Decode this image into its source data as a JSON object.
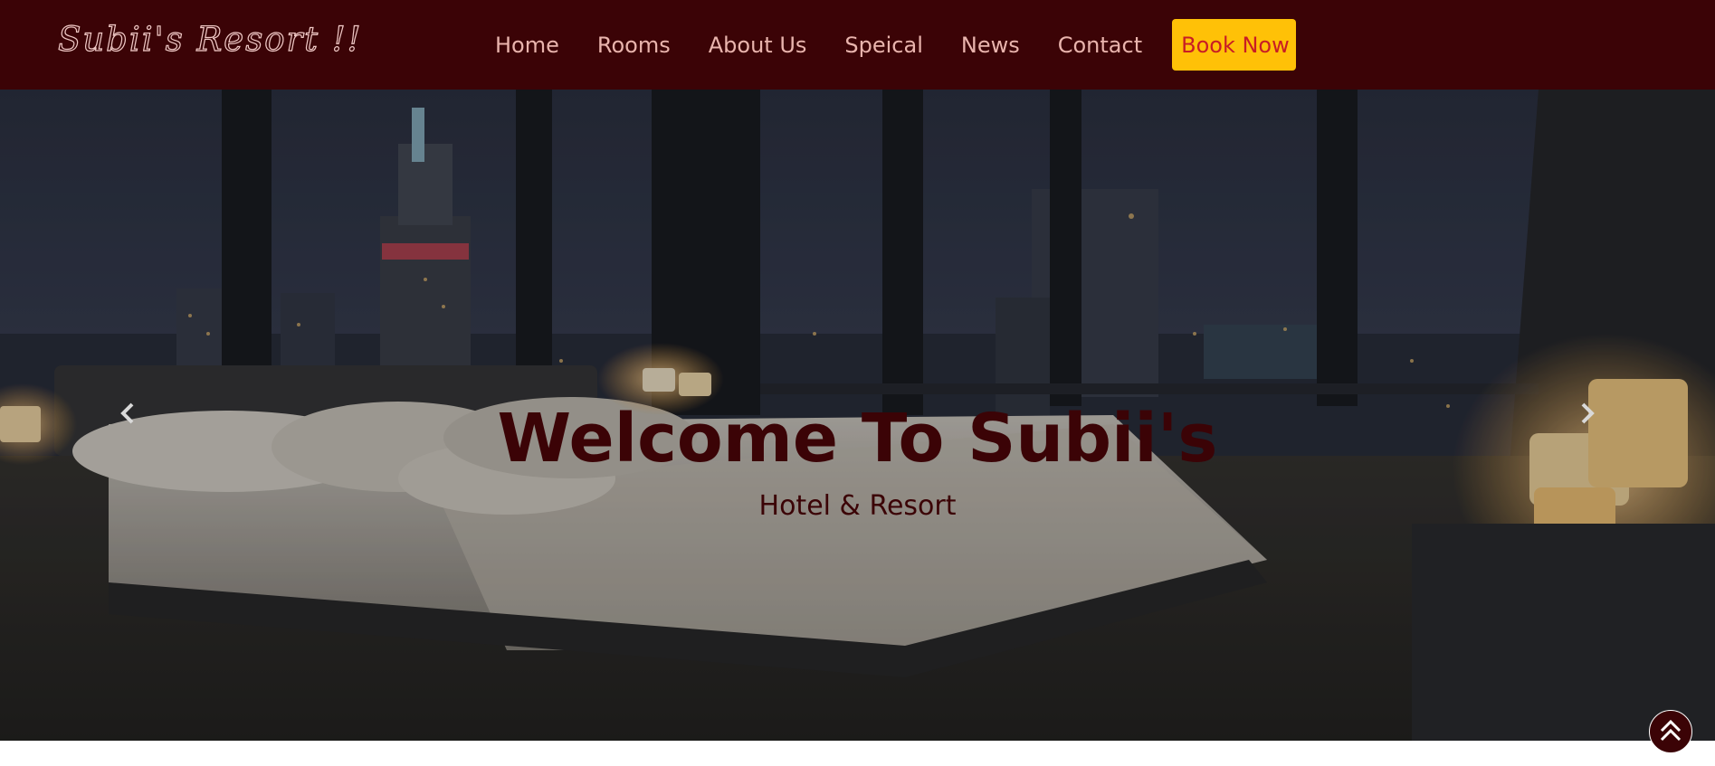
{
  "brand": {
    "name": "Subii's Resort !!"
  },
  "nav": {
    "items": [
      {
        "label": "Home"
      },
      {
        "label": "Rooms"
      },
      {
        "label": "About Us"
      },
      {
        "label": "Speical"
      },
      {
        "label": "News"
      },
      {
        "label": "Contact"
      }
    ],
    "cta_label": "Book Now"
  },
  "hero": {
    "title": "Welcome To Subii's",
    "subtitle": "Hotel & Resort",
    "prev_icon": "chevron-left-icon",
    "next_icon": "chevron-right-icon"
  },
  "scroll_top": {
    "icon": "double-chevron-up-icon"
  },
  "colors": {
    "navbar_bg": "#3b0306",
    "nav_text": "#e9b4ad",
    "cta_bg": "#ffc107",
    "cta_text": "#c81d25",
    "hero_text": "#3b0306"
  }
}
